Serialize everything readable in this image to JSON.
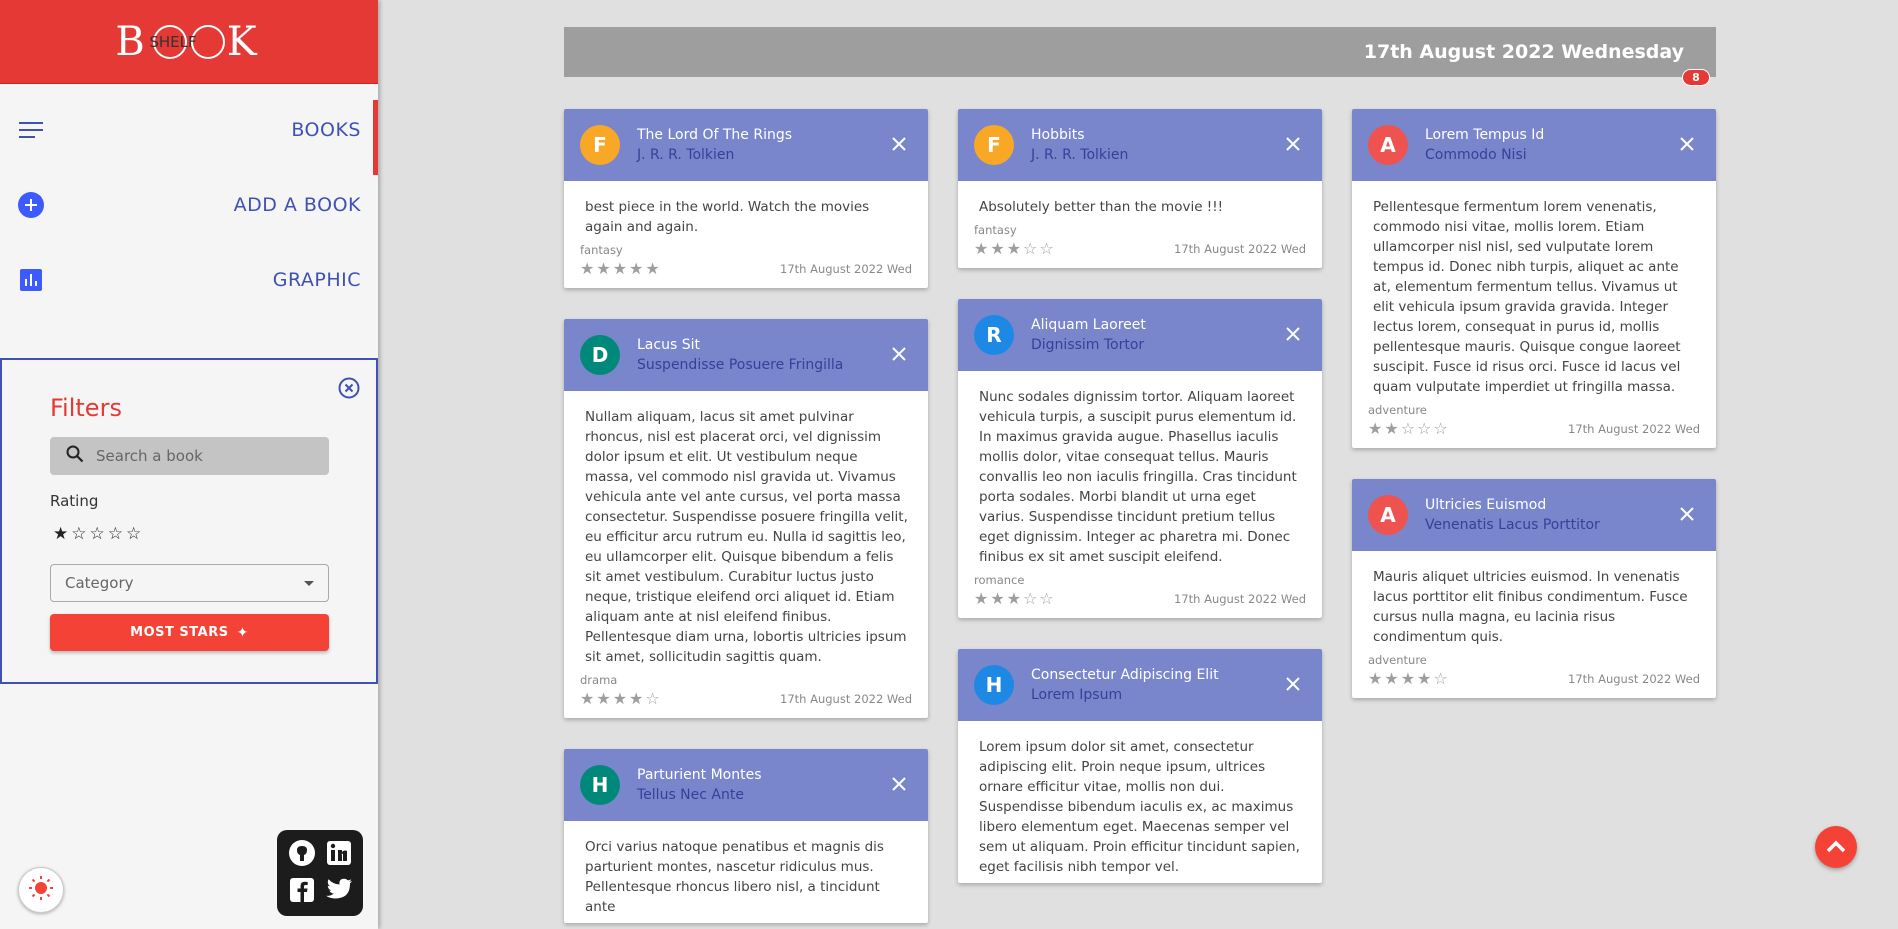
{
  "logo": {
    "left": "B",
    "right": "K",
    "overlay": "SHELF"
  },
  "nav": [
    {
      "label": "BOOKS",
      "icon": "menu-icon"
    },
    {
      "label": "ADD A BOOK",
      "icon": "add-circle-icon"
    },
    {
      "label": "GRAPHIC",
      "icon": "bar-chart-icon"
    }
  ],
  "filters": {
    "title": "Filters",
    "search_placeholder": "Search a book",
    "rating_label": "Rating",
    "rating_value": 1,
    "category_placeholder": "Category",
    "sort_button": "MOST STARS"
  },
  "header": {
    "date": "17th August 2022 Wednesday",
    "badge": "8"
  },
  "columns": [
    [
      {
        "initial": "F",
        "avatar_color": "#f9a825",
        "title": "The Lord Of The Rings",
        "author": "J. R. R. Tolkien",
        "review": "best piece in the world. Watch the movies again and again.",
        "genre": "fantasy",
        "stars": 5,
        "date": "17th August 2022 Wed"
      },
      {
        "initial": "D",
        "avatar_color": "#00897b",
        "title": "Lacus Sit",
        "author": "Suspendisse Posuere Fringilla",
        "review": "Nullam aliquam, lacus sit amet pulvinar rhoncus, nisl est placerat orci, vel dignissim dolor ipsum et elit. Ut vestibulum neque massa, vel commodo nisl gravida ut. Vivamus vehicula ante vel ante cursus, vel porta massa consectetur. Suspendisse posuere fringilla velit, eu efficitur arcu rutrum eu. Nulla id sagittis leo, eu ullamcorper elit. Quisque bibendum a felis sit amet vestibulum. Curabitur luctus justo neque, tristique eleifend orci aliquet id. Etiam aliquam ante at nisl eleifend finibus. Pellentesque diam urna, lobortis ultricies ipsum sit amet, sollicitudin sagittis quam.",
        "genre": "drama",
        "stars": 4,
        "date": "17th August 2022 Wed"
      },
      {
        "initial": "H",
        "avatar_color": "#00897b",
        "title": "Parturient Montes",
        "author": "Tellus Nec Ante",
        "review": "Orci varius natoque penatibus et magnis dis parturient montes, nascetur ridiculus mus. Pellentesque rhoncus libero nisl, a tincidunt ante",
        "genre": "",
        "stars": 0,
        "date": ""
      }
    ],
    [
      {
        "initial": "F",
        "avatar_color": "#f9a825",
        "title": "Hobbits",
        "author": "J. R. R. Tolkien",
        "review": "Absolutely better than the movie !!!",
        "genre": "fantasy",
        "stars": 3,
        "date": "17th August 2022 Wed"
      },
      {
        "initial": "R",
        "avatar_color": "#1e88e5",
        "title": "Aliquam Laoreet",
        "author": "Dignissim Tortor",
        "review": "Nunc sodales dignissim tortor. Aliquam laoreet vehicula turpis, a suscipit purus elementum id. In maximus gravida augue. Phasellus iaculis mollis dolor, vitae consequat tellus. Mauris convallis leo non iaculis fringilla. Cras tincidunt porta sodales. Morbi blandit ut urna eget varius. Suspendisse tincidunt pretium tellus eget dignissim. Integer ac pharetra mi. Donec finibus ex sit amet suscipit eleifend.",
        "genre": "romance",
        "stars": 3,
        "date": "17th August 2022 Wed"
      },
      {
        "initial": "H",
        "avatar_color": "#1e88e5",
        "title": "Consectetur Adipiscing Elit",
        "author": "Lorem Ipsum",
        "review": "Lorem ipsum dolor sit amet, consectetur adipiscing elit. Proin neque ipsum, ultrices ornare efficitur vitae, mollis non dui. Suspendisse bibendum iaculis ex, ac maximus libero elementum eget. Maecenas semper vel sem ut aliquam. Proin efficitur tincidunt sapien, eget facilisis nibh tempor vel.",
        "genre": "",
        "stars": 0,
        "date": ""
      }
    ],
    [
      {
        "initial": "A",
        "avatar_color": "#ef5350",
        "title": "Lorem Tempus Id",
        "author": "Commodo Nisi",
        "review": "Pellentesque fermentum lorem venenatis, commodo nisi vitae, mollis lorem. Etiam ullamcorper nisl nisl, sed vulputate lorem tempus id. Donec nibh turpis, aliquet ac ante at, elementum fermentum tellus. Vivamus ut elit vehicula ipsum gravida gravida. Integer lectus lorem, consequat in purus id, mollis pellentesque mauris. Quisque congue laoreet suscipit. Fusce id risus orci. Fusce id lacus vel quam vulputate imperdiet ut fringilla massa.",
        "genre": "adventure",
        "stars": 2,
        "date": "17th August 2022 Wed"
      },
      {
        "initial": "A",
        "avatar_color": "#ef5350",
        "title": "Ultricies Euismod",
        "author": "Venenatis Lacus Porttitor",
        "review": "Mauris aliquet ultricies euismod. In venenatis lacus porttitor elit finibus condimentum. Fusce cursus nulla magna, eu lacinia risus condimentum quis.",
        "genre": "adventure",
        "stars": 4,
        "date": "17th August 2022 Wed"
      }
    ]
  ]
}
